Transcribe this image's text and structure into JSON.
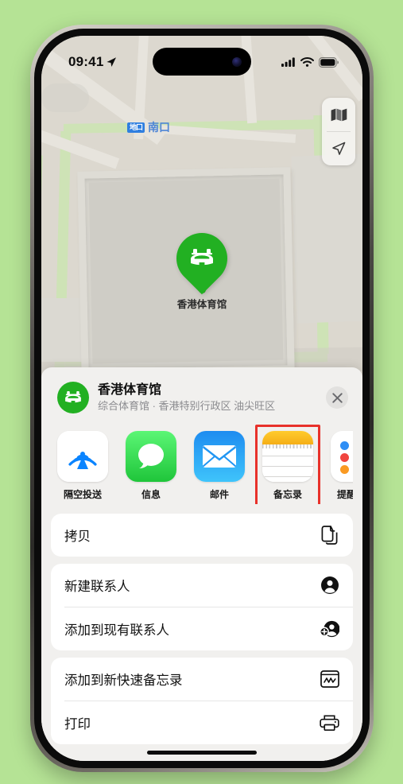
{
  "status_bar": {
    "time": "09:41",
    "location_arrow": "location-arrow-icon",
    "cellular": "signal-bars-icon",
    "wifi": "wifi-icon",
    "battery": "battery-full-icon"
  },
  "map": {
    "transit_badge": {
      "code": "地口",
      "label": "南口"
    },
    "pin": {
      "label": "香港体育馆",
      "color": "#22b022",
      "glyph": "stadium-icon"
    },
    "controls": [
      {
        "name": "map-layers-button",
        "icon": "folded-map-icon"
      },
      {
        "name": "locate-me-button",
        "icon": "location-arrow-icon"
      }
    ]
  },
  "share_sheet": {
    "title": "香港体育馆",
    "subtitle": "综合体育馆 · 香港特别行政区 油尖旺区",
    "avatar_icon": "stadium-icon",
    "avatar_color": "#22b022",
    "close_label": "✕",
    "apps": [
      {
        "label": "隔空投送",
        "icon": "airdrop-icon",
        "highlighted": false
      },
      {
        "label": "信息",
        "icon": "messages-icon",
        "highlighted": false
      },
      {
        "label": "邮件",
        "icon": "mail-icon",
        "highlighted": false
      },
      {
        "label": "备忘录",
        "icon": "notes-icon",
        "highlighted": true
      },
      {
        "label": "提醒事项",
        "icon": "reminders-icon",
        "highlighted": false
      }
    ],
    "highlight_color": "#e8312a",
    "action_groups": [
      {
        "rows": [
          {
            "label": "拷贝",
            "icon": "copy-icon"
          }
        ]
      },
      {
        "rows": [
          {
            "label": "新建联系人",
            "icon": "new-contact-icon"
          },
          {
            "label": "添加到现有联系人",
            "icon": "add-to-contact-icon"
          }
        ]
      },
      {
        "rows": [
          {
            "label": "添加到新快速备忘录",
            "icon": "quick-note-icon"
          },
          {
            "label": "打印",
            "icon": "printer-icon"
          }
        ]
      }
    ]
  }
}
